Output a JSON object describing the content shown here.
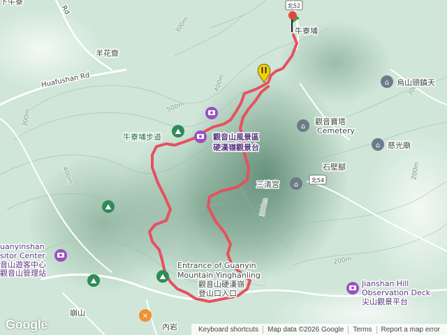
{
  "map": {
    "place_labels": {
      "niuliaobu": "牛寮埔",
      "yanghuazhai": "羊花齋",
      "niuliaobu_trail": "牛寮埔步道",
      "guanyinshan_scenic_1": "觀音山風景區",
      "guanyinshan_scenic_2": "硬漢嶺觀景台",
      "guanyin_tower": "觀音寶塔",
      "cemetery": "Cemetery",
      "shibijiao": "石壁腳",
      "sanqinggong": "三清宮",
      "ciguangmiao": "慈光廟",
      "wushantou": "烏山頭鎮天",
      "entrance_en_1": "Entrance of Guanyin",
      "entrance_en_2": "Mountain Yinghanling",
      "entrance_zh_1": "觀音山硬漢嶺",
      "entrance_zh_2": "登山口入口",
      "visitor_en_1": "uanyinshan",
      "visitor_en_2": "sitor Center",
      "visitor_zh_1": "音山遊客中心",
      "visitor_zh_2": "觀音山管理站",
      "jianshan_en_1": "Jianshan Hill",
      "jianshan_en_2": "Observation Deck",
      "jianshan_zh": "尖山觀景平台",
      "bengshan": "崩山",
      "neiyan": "內岩",
      "xiashipu": "下牛寮"
    },
    "roads": {
      "huafushan": "Huafushan Rd",
      "rd_top": "Rd",
      "shield_north52": "北52",
      "shield_north54": "北54"
    },
    "contours": {
      "c300a": "300m",
      "c300b": "300m",
      "c400a": "400m",
      "c400b": "400m",
      "c500": "500m",
      "c200a": "200m",
      "c200b": "200m",
      "c300c": "300m",
      "c300d": "300m"
    },
    "route": {
      "color": "#e5515f",
      "start_marker_color": "#2bb24c",
      "end_marker_color": "#e8443a",
      "pin_marker_color": "#f5d000"
    }
  },
  "google_logo": "Google",
  "attribution": {
    "keyboard": "Keyboard shortcuts",
    "map_data": "Map data ©2026 Google",
    "terms": "Terms",
    "report": "Report a map error"
  }
}
